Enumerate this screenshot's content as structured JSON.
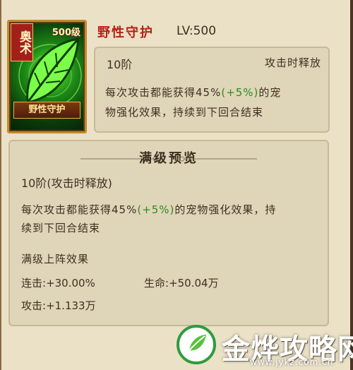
{
  "card": {
    "badge": "奥术",
    "level_tag": "500级",
    "name": "野性守护"
  },
  "skill": {
    "title": "野性守护",
    "level": "LV:500"
  },
  "current": {
    "tier": "10阶",
    "trigger": "攻击时释放",
    "line1_a": "每次攻击都能获得45%",
    "line1_b": "(+5%)",
    "line1_c": "的宠",
    "line2": "物强化效果，持续到下回合结束"
  },
  "max_preview": {
    "heading": "满级预览",
    "tier": "10阶(攻击时释放)",
    "line1_a": "每次攻击都能获得45%",
    "line1_b": "(+5%)",
    "line1_c": "的宠物强化效果，持",
    "line2": "续到下回合结束",
    "sub_heading": "满级上阵效果",
    "stats": [
      {
        "label": "连击",
        "value": ":+30.00%"
      },
      {
        "label": "生命",
        "value": ":+50.04万"
      },
      {
        "label": "攻击",
        "value": ":+1.133万"
      }
    ]
  },
  "watermark": {
    "text": "金烨攻略网",
    "url": "www.jykz.com.cn"
  },
  "colors": {
    "title_red": "#b42115",
    "bonus_green": "#2f8a1d",
    "panel_bg": "#dfd5b9"
  }
}
